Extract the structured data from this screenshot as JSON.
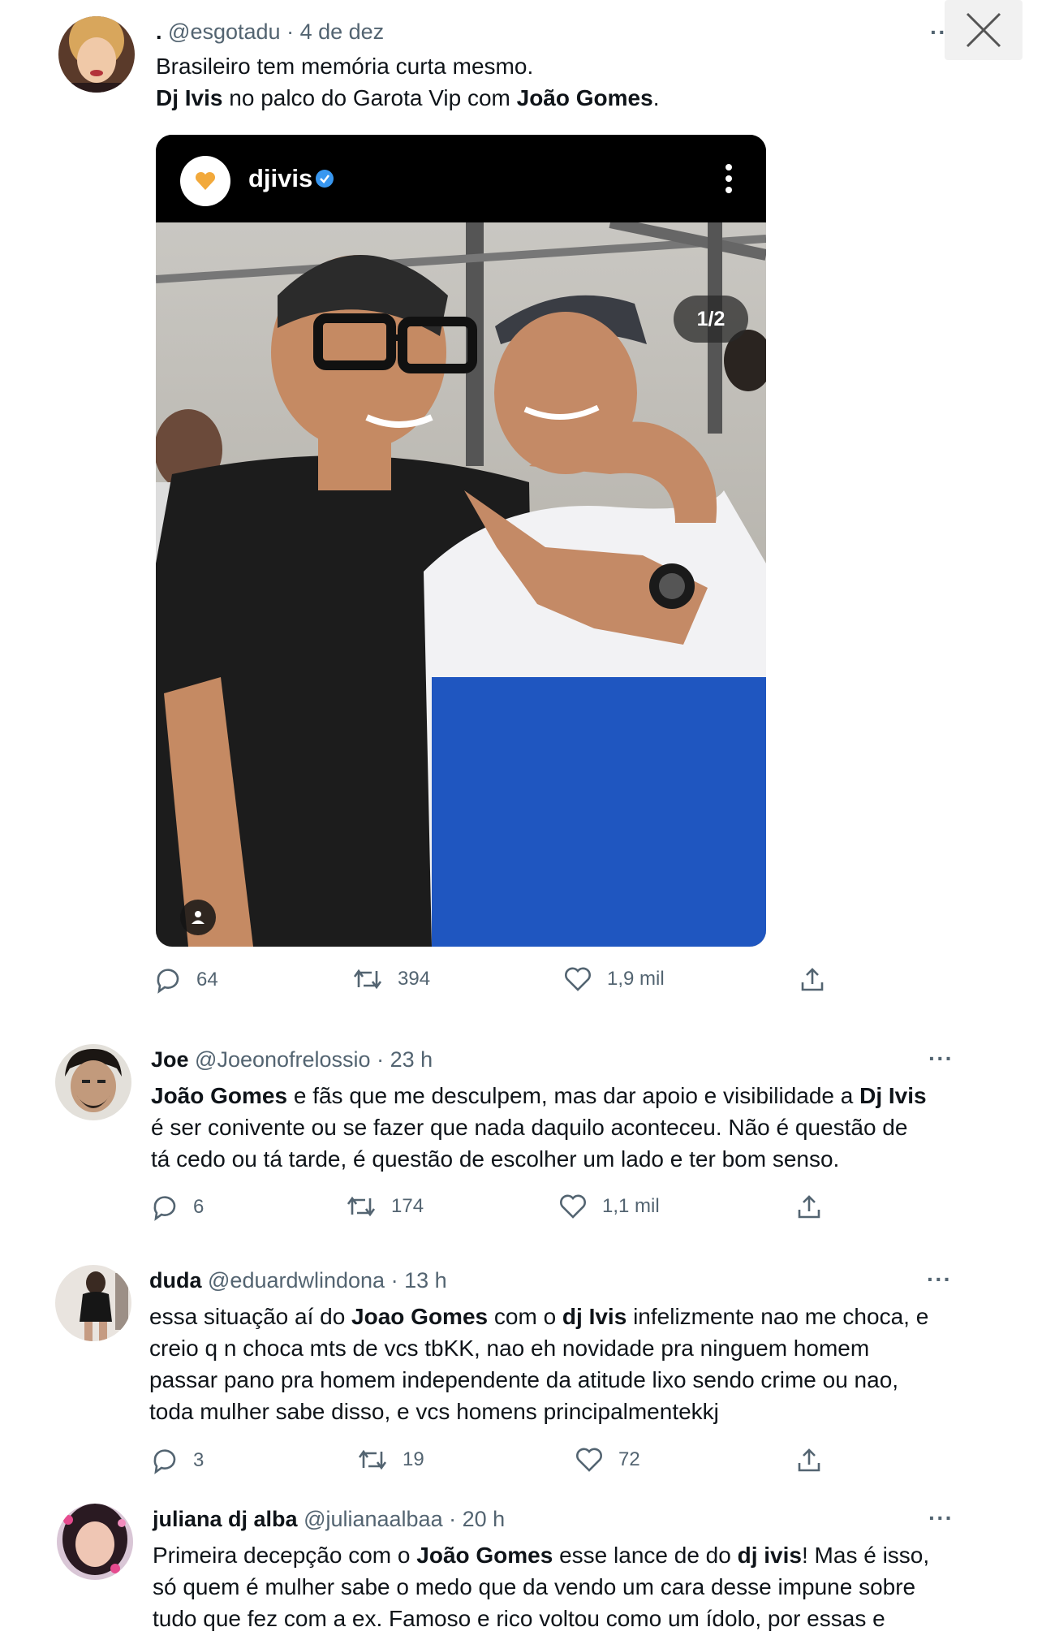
{
  "close": {
    "icon": "close-icon"
  },
  "tweets": [
    {
      "name": ".",
      "handle": "@esgotadu",
      "time": "4 de dez",
      "lines": [
        [
          {
            "t": "Brasileiro tem memória curta mesmo.",
            "b": false
          }
        ],
        [
          {
            "t": "Dj Ivis",
            "b": true
          },
          {
            "t": " no palco do Garota Vip com ",
            "b": false
          },
          {
            "t": "João Gomes",
            "b": true
          },
          {
            "t": ".",
            "b": false
          }
        ]
      ],
      "media": {
        "username": "djivis",
        "pager": "1/2"
      },
      "replies": "64",
      "retweets": "394",
      "likes": "1,9 mil"
    },
    {
      "name": "Joe",
      "handle": "@Joeonofrelossio",
      "time": "23 h",
      "lines": [
        [
          {
            "t": "João Gomes",
            "b": true
          },
          {
            "t": " e fãs que me desculpem, mas dar apoio e visibilidade a ",
            "b": false
          },
          {
            "t": "Dj Ivis",
            "b": true
          }
        ],
        [
          {
            "t": "é ser conivente ou se fazer que nada daquilo aconteceu. Não é questão de",
            "b": false
          }
        ],
        [
          {
            "t": "tá cedo ou tá tarde, é questão de escolher um lado e ter bom senso.",
            "b": false
          }
        ]
      ],
      "replies": "6",
      "retweets": "174",
      "likes": "1,1 mil"
    },
    {
      "name": "duda",
      "handle": "@eduardwlindona",
      "time": "13 h",
      "lines": [
        [
          {
            "t": "essa situação aí do ",
            "b": false
          },
          {
            "t": "Joao Gomes",
            "b": true
          },
          {
            "t": " com o ",
            "b": false
          },
          {
            "t": "dj Ivis",
            "b": true
          },
          {
            "t": " infelizmente nao me choca, e",
            "b": false
          }
        ],
        [
          {
            "t": "creio q n choca mts de vcs tbKK, nao eh novidade pra ninguem homem",
            "b": false
          }
        ],
        [
          {
            "t": "passar pano pra homem independente da atitude lixo sendo crime ou nao,",
            "b": false
          }
        ],
        [
          {
            "t": "toda mulher sabe disso, e vcs homens principalmentekkj",
            "b": false
          }
        ]
      ],
      "replies": "3",
      "retweets": "19",
      "likes": "72"
    },
    {
      "name": "juliana dj alba",
      "handle": "@julianaalbaa",
      "time": "20 h",
      "lines": [
        [
          {
            "t": "Primeira decepção com o ",
            "b": false
          },
          {
            "t": "João Gomes",
            "b": true
          },
          {
            "t": " esse lance de do ",
            "b": false
          },
          {
            "t": "dj ivis",
            "b": true
          },
          {
            "t": "! Mas é isso,",
            "b": false
          }
        ],
        [
          {
            "t": "só quem é mulher sabe o medo que da vendo um cara desse impune sobre",
            "b": false
          }
        ],
        [
          {
            "t": "tudo que fez com a ex. Famoso e rico voltou como um ídolo, por essas e",
            "b": false
          }
        ]
      ]
    }
  ],
  "icons": {
    "reply": "reply-icon",
    "retweet": "retweet-icon",
    "like": "heart-icon",
    "share": "share-icon",
    "more": "more-icon"
  }
}
